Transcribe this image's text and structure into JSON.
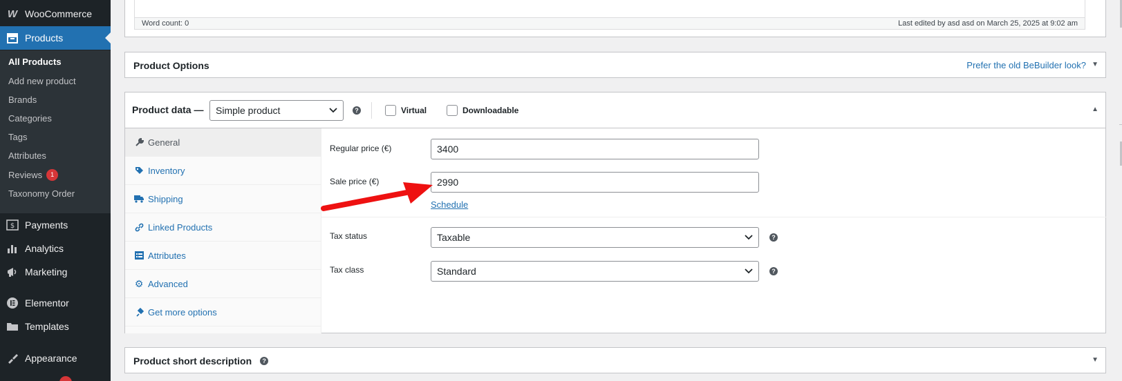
{
  "sidebar": {
    "woocommerce": "WooCommerce",
    "products": "Products",
    "submenu": [
      {
        "label": "All Products"
      },
      {
        "label": "Add new product"
      },
      {
        "label": "Brands"
      },
      {
        "label": "Categories"
      },
      {
        "label": "Tags"
      },
      {
        "label": "Attributes"
      },
      {
        "label": "Reviews",
        "badge": "1"
      },
      {
        "label": "Taxonomy Order"
      }
    ],
    "payments": "Payments",
    "analytics": "Analytics",
    "marketing": "Marketing",
    "elementor": "Elementor",
    "templates": "Templates",
    "appearance": "Appearance"
  },
  "editor": {
    "word_count": "Word count: 0",
    "last_edited": "Last edited by asd asd on March 25, 2025 at 9:02 am"
  },
  "product_options": {
    "title": "Product Options",
    "bebuilder_link": "Prefer the old BeBuilder look?"
  },
  "product_data": {
    "title": "Product data —",
    "type_selected": "Simple product",
    "virtual_label": "Virtual",
    "downloadable_label": "Downloadable",
    "tabs": [
      {
        "label": "General"
      },
      {
        "label": "Inventory"
      },
      {
        "label": "Shipping"
      },
      {
        "label": "Linked Products"
      },
      {
        "label": "Attributes"
      },
      {
        "label": "Advanced"
      },
      {
        "label": "Get more options"
      }
    ],
    "general": {
      "regular_price_label": "Regular price (€)",
      "regular_price_value": "3400",
      "sale_price_label": "Sale price (€)",
      "sale_price_value": "2990",
      "schedule_link": "Schedule",
      "tax_status_label": "Tax status",
      "tax_status_value": "Taxable",
      "tax_class_label": "Tax class",
      "tax_class_value": "Standard"
    }
  },
  "short_description": {
    "title": "Product short description"
  },
  "colors": {
    "sidebar_bg": "#1d2327",
    "accent": "#2271b1",
    "arrow": "#ee1111",
    "badge": "#d63638"
  }
}
